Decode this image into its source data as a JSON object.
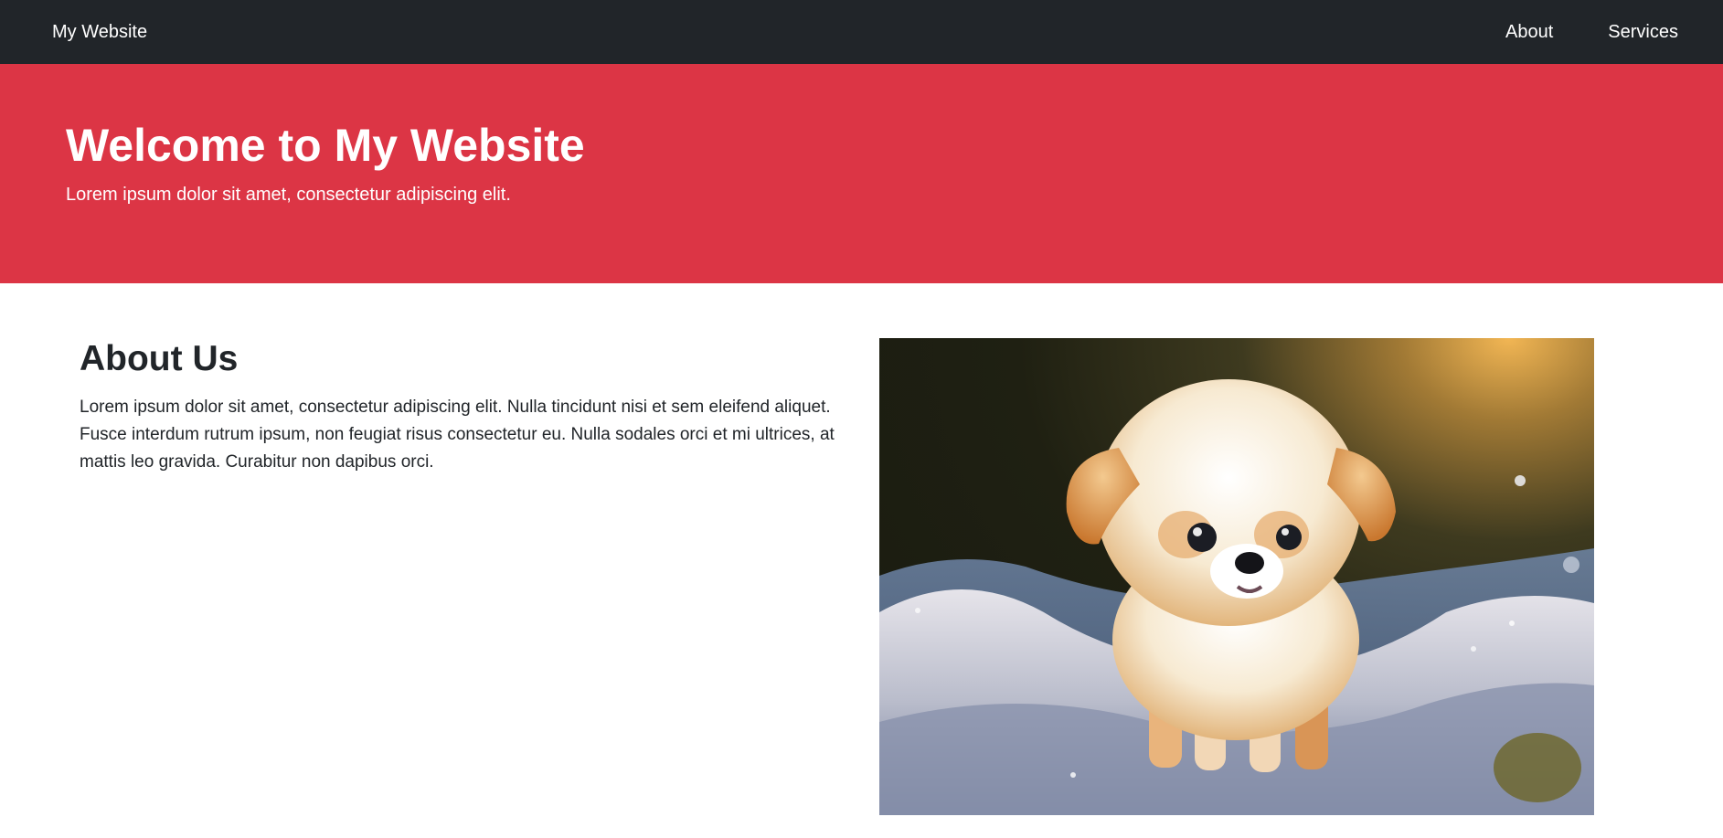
{
  "navbar": {
    "brand": "My Website",
    "links": [
      "About",
      "Services"
    ]
  },
  "hero": {
    "title": "Welcome to My Website",
    "subtitle": "Lorem ipsum dolor sit amet, consectetur adipiscing elit."
  },
  "about": {
    "heading": "About Us",
    "body": "Lorem ipsum dolor sit amet, consectetur adipiscing elit. Nulla tincidunt nisi et sem eleifend aliquet. Fusce interdum rutrum ipsum, non feugiat risus consectetur eu. Nulla sodales orci et mi ultrices, at mattis leo gravida. Curabitur non dapibus orci."
  },
  "colors": {
    "navbar_bg": "#212529",
    "hero_bg": "#dc3545",
    "text_dark": "#212529"
  }
}
